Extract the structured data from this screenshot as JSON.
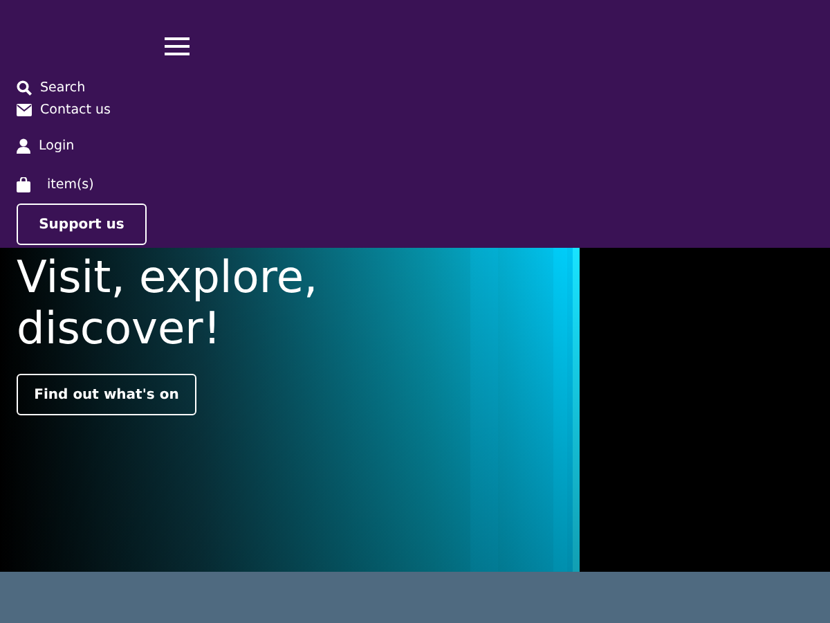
{
  "header": {
    "links": [
      {
        "kind": "search",
        "label": "Search"
      },
      {
        "kind": "mail",
        "label": "Contact us"
      },
      {
        "kind": "user",
        "label": "Login"
      },
      {
        "kind": "bag",
        "label": "item(s)"
      }
    ],
    "support_button": "Support us"
  },
  "hero": {
    "heading": "Visit, explore, discover!",
    "button": "Find out what's on"
  }
}
